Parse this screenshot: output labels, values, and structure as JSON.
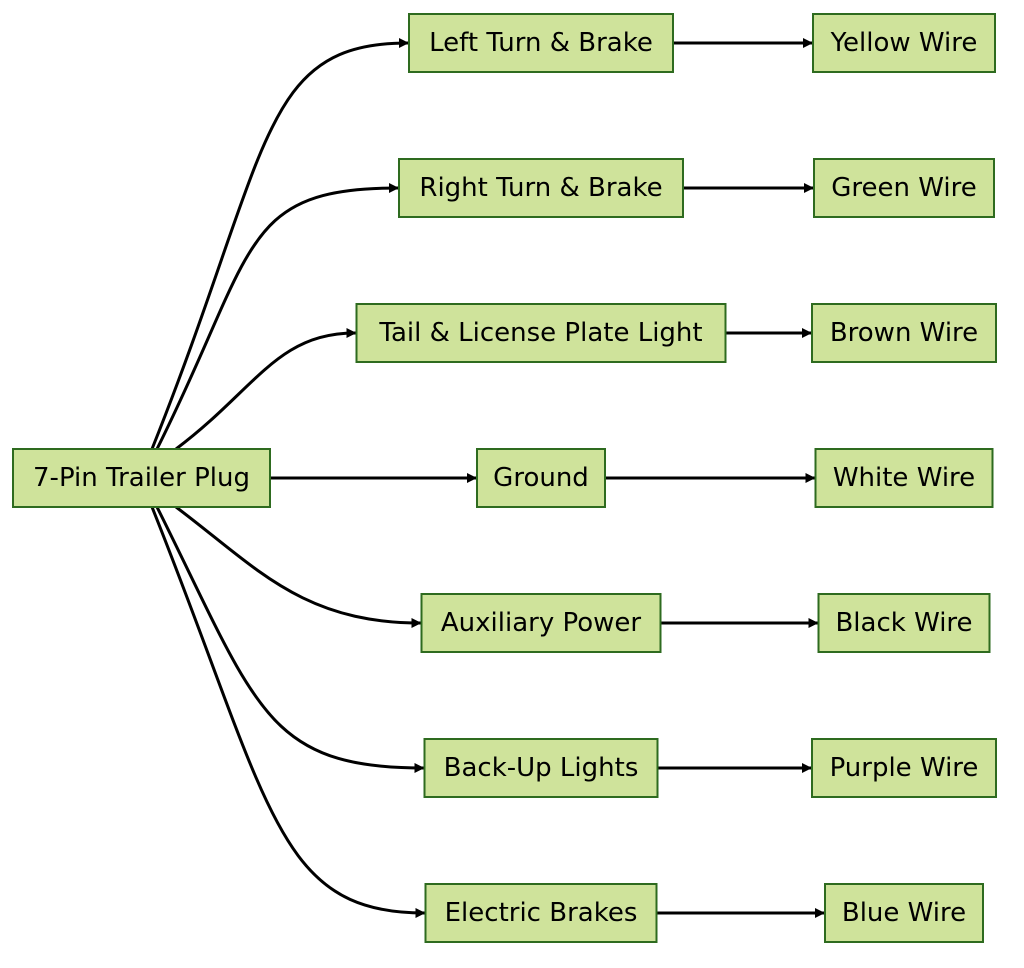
{
  "diagram": {
    "type": "flowchart",
    "direction": "left-to-right",
    "colors": {
      "node_fill": "#cfe39b",
      "node_border": "#2e6b1f",
      "edge": "#000000",
      "background": "#ffffff"
    },
    "root": {
      "id": "plug",
      "label": "7-Pin Trailer Plug"
    },
    "functions": [
      {
        "id": "left-turn",
        "label": "Left Turn & Brake",
        "wire": "Yellow Wire"
      },
      {
        "id": "right-turn",
        "label": "Right Turn & Brake",
        "wire": "Green Wire"
      },
      {
        "id": "tail-light",
        "label": "Tail & License Plate Light",
        "wire": "Brown Wire"
      },
      {
        "id": "ground",
        "label": "Ground",
        "wire": "White Wire"
      },
      {
        "id": "aux-power",
        "label": "Auxiliary Power",
        "wire": "Black Wire"
      },
      {
        "id": "backup-lights",
        "label": "Back-Up Lights",
        "wire": "Purple Wire"
      },
      {
        "id": "electric-brakes",
        "label": "Electric Brakes",
        "wire": "Blue Wire"
      }
    ],
    "edges": [
      [
        "plug",
        "left-turn"
      ],
      [
        "plug",
        "right-turn"
      ],
      [
        "plug",
        "tail-light"
      ],
      [
        "plug",
        "ground"
      ],
      [
        "plug",
        "aux-power"
      ],
      [
        "plug",
        "backup-lights"
      ],
      [
        "plug",
        "electric-brakes"
      ],
      [
        "left-turn",
        "yellow-wire"
      ],
      [
        "right-turn",
        "green-wire"
      ],
      [
        "tail-light",
        "brown-wire"
      ],
      [
        "ground",
        "white-wire"
      ],
      [
        "aux-power",
        "black-wire"
      ],
      [
        "backup-lights",
        "purple-wire"
      ],
      [
        "electric-brakes",
        "blue-wire"
      ]
    ]
  }
}
